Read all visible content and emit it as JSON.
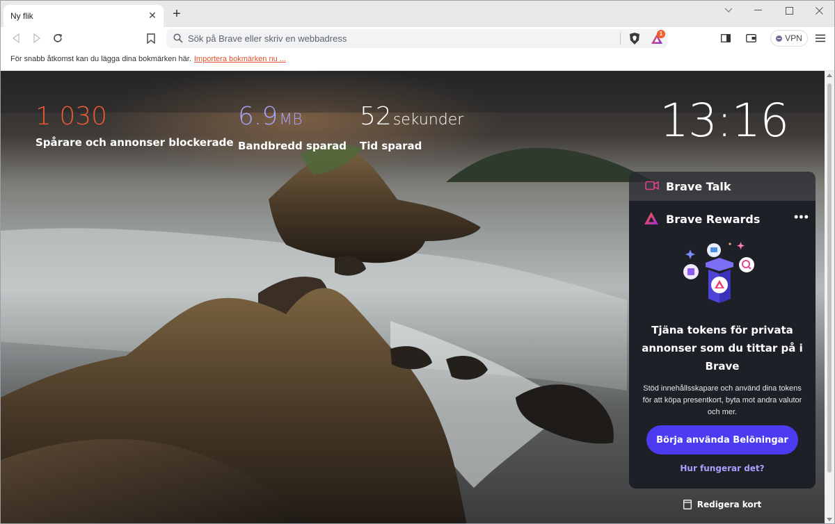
{
  "tab": {
    "title": "Ny flik",
    "close_icon": "close-icon"
  },
  "window_controls": [
    "minimize-icon",
    "maximize-icon",
    "close-icon"
  ],
  "toolbar": {
    "search_placeholder": "Sök på Brave eller skriv en webbadress",
    "rewards_badge_count": "1",
    "vpn_label": "VPN"
  },
  "bookmarks_bar": {
    "text": "För snabb åtkomst kan du lägga dina bokmärken här.",
    "import_link": "Importera bokmärken nu ..."
  },
  "stats": {
    "trackers": {
      "value": "1 030",
      "label": "Spårare och annonser blockerade",
      "color": "#f15a32"
    },
    "bandwidth": {
      "value": "6.9",
      "unit": "MB",
      "label": "Bandbredd sparad",
      "color": "#a7a2ff"
    },
    "time": {
      "value": "52",
      "unit": "sekunder",
      "label": "Tid sparad",
      "color": "#ffffff"
    }
  },
  "clock": "13:16",
  "widgets": {
    "talk_title": "Brave Talk",
    "rewards_title": "Brave Rewards",
    "rewards_heading": "Tjäna tokens för privata annonser som du tittar på i Brave",
    "rewards_text": "Stöd innehållsskapare och använd dina tokens för att köpa presentkort, byta mot andra valutor och mer.",
    "rewards_button": "Börja använda Belöningar",
    "rewards_link": "Hur fungerar det?",
    "edit_cards": "Redigera kort"
  },
  "colors": {
    "accent_button": "#4c3bf0",
    "link": "#a6a1ff",
    "import_link": "#e0522d"
  }
}
